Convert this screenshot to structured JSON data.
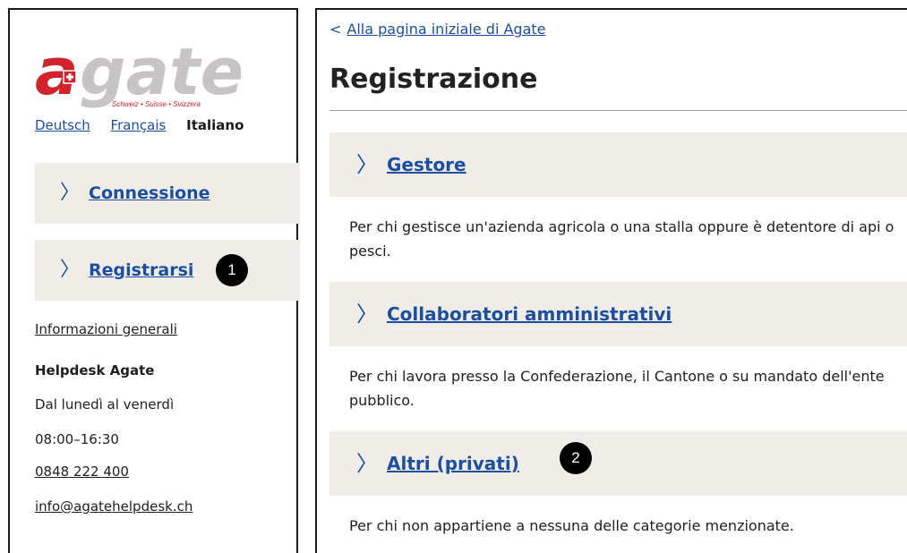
{
  "logo": {
    "wordmark": "agate",
    "tagline": "Schweiz • Suisse • Svizzera",
    "brand_color": "#d2232a",
    "wordmark_color": "#c9c4c4"
  },
  "languages": [
    {
      "label": "Deutsch",
      "active": false
    },
    {
      "label": "Français",
      "active": false
    },
    {
      "label": "Italiano",
      "active": true
    }
  ],
  "left_nav": [
    {
      "label": "Connessione"
    },
    {
      "label": "Registrarsi"
    }
  ],
  "markers": [
    "1",
    "2"
  ],
  "info": {
    "general_link": "Informazioni generali",
    "helpdesk_title": "Helpdesk Agate",
    "days": "Dal lunedì al venerdì",
    "hours": "08:00–16:30",
    "phone": "0848 222 400",
    "email": "info@agatehelpdesk.ch"
  },
  "main": {
    "back_link": "Alla pagina iniziale di Agate",
    "title": "Registrazione",
    "sections": [
      {
        "label": "Gestore",
        "description": "Per chi gestisce un'azienda agricola o una stalla oppure è detentore di api o pesci."
      },
      {
        "label": "Collaboratori amministrativi",
        "description": "Per chi lavora presso la Confederazione, il Cantone o su mandato dell'ente pubblico."
      },
      {
        "label": "Altri (privati)",
        "description": "Per chi non appartiene a nessuna delle categorie menzionate."
      }
    ]
  },
  "colors": {
    "link": "#1c4fa0",
    "nav_bg": "#f0ede8"
  }
}
